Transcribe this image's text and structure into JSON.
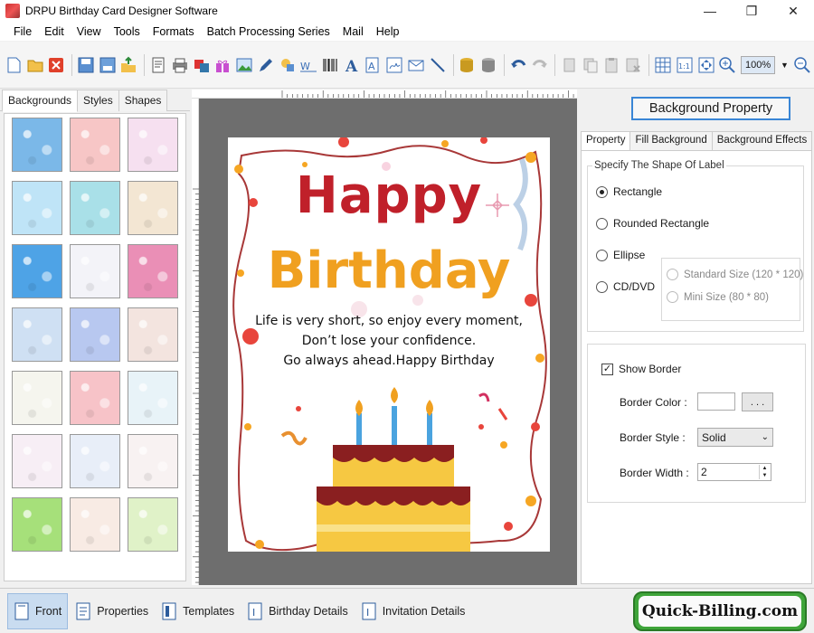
{
  "window": {
    "title": "DRPU Birthday Card Designer Software"
  },
  "menu": [
    "File",
    "Edit",
    "View",
    "Tools",
    "Formats",
    "Batch Processing Series",
    "Mail",
    "Help"
  ],
  "toolbar": {
    "zoom": "100%"
  },
  "left_panel": {
    "tabs": [
      "Backgrounds",
      "Styles",
      "Shapes"
    ],
    "active_tab": "Backgrounds",
    "thumbnails": [
      {
        "pattern": "sky-clouds",
        "color": "#7bb8e8"
      },
      {
        "pattern": "pink-roses",
        "color": "#f7c6c6"
      },
      {
        "pattern": "butterflies",
        "color": "#f6e0f0"
      },
      {
        "pattern": "daisies",
        "color": "#bfe4f7"
      },
      {
        "pattern": "cartoon-animals",
        "color": "#a9e0e8"
      },
      {
        "pattern": "balloons-bird",
        "color": "#f3e6d3"
      },
      {
        "pattern": "stars-blue",
        "color": "#4ea3e6"
      },
      {
        "pattern": "balloons-pastel",
        "color": "#f3f3f8"
      },
      {
        "pattern": "pink-gifts",
        "color": "#ea8fb6"
      },
      {
        "pattern": "bubbles",
        "color": "#cfe0f3"
      },
      {
        "pattern": "rainbow-blur",
        "color": "#b8c8f0"
      },
      {
        "pattern": "teddy-bear",
        "color": "#f3e4df"
      },
      {
        "pattern": "happy-birthday-text",
        "color": "#f5f5ee"
      },
      {
        "pattern": "pink-ribbons",
        "color": "#f7c3c8"
      },
      {
        "pattern": "party-balloons",
        "color": "#e8f3f8"
      },
      {
        "pattern": "hearts-pastel",
        "color": "#f7eef5"
      },
      {
        "pattern": "balloon-bunches",
        "color": "#e8eef8"
      },
      {
        "pattern": "red-hearts",
        "color": "#f8f2f2"
      },
      {
        "pattern": "green-stripes",
        "color": "#a6e07a"
      },
      {
        "pattern": "cakes-pink",
        "color": "#f8ebe4"
      },
      {
        "pattern": "flowers-meadow",
        "color": "#e0f2c8"
      }
    ]
  },
  "card": {
    "title1": "Happy",
    "title2": "Birthday",
    "lines": [
      "Life is very short, so enjoy every moment,",
      "Don’t lose your confidence.",
      "Go always ahead.Happy Birthday"
    ]
  },
  "right_panel": {
    "header_button": "Background Property",
    "tabs": [
      "Property",
      "Fill Background",
      "Background Effects"
    ],
    "shape_group_title": "Specify The Shape Of Label",
    "shapes": [
      {
        "label": "Rectangle",
        "checked": true
      },
      {
        "label": "Rounded Rectangle",
        "checked": false
      },
      {
        "label": "Ellipse",
        "checked": false
      },
      {
        "label": "CD/DVD",
        "checked": false
      }
    ],
    "cd_sizes": [
      "Standard Size (120 * 120)",
      "Mini Size (80 * 80)"
    ],
    "show_border_label": "Show Border",
    "border_color_label": "Border Color :",
    "browse_button": ". . .",
    "border_style_label": "Border Style :",
    "border_style_value": "Solid",
    "border_width_label": "Border Width :",
    "border_width_value": "2"
  },
  "bottom_bar": {
    "items": [
      "Front",
      "Properties",
      "Templates",
      "Birthday Details",
      "Invitation Details"
    ],
    "active": "Front",
    "brand": "Quick-Billing.com"
  },
  "colors": {
    "happy": "#c0202a",
    "birthday": "#f0a020",
    "accent": "#3a86d6",
    "brand_green": "#3fa53a"
  }
}
